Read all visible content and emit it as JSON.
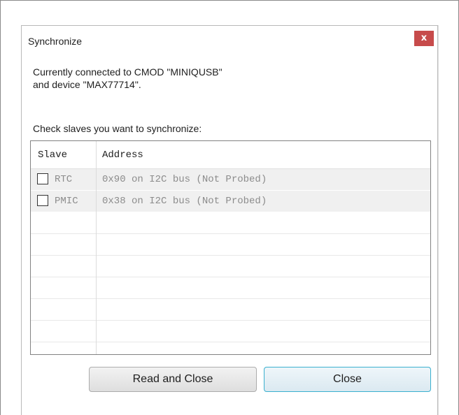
{
  "window": {
    "title": "Synchronize",
    "close_glyph": "x"
  },
  "info": {
    "line1": "Currently connected to CMOD \"MINIQUSB\"",
    "line2": "and device \"MAX77714\"."
  },
  "prompt": "Check slaves you want to synchronize:",
  "table": {
    "headers": {
      "slave": "Slave",
      "address": "Address"
    },
    "rows": [
      {
        "slave": "RTC",
        "address": "0x90 on I2C bus (Not Probed)",
        "checked": false
      },
      {
        "slave": "PMIC",
        "address": "0x38 on I2C bus (Not Probed)",
        "checked": false
      }
    ]
  },
  "buttons": {
    "read_and_close": "Read and Close",
    "close": "Close"
  },
  "colors": {
    "close_button": "#c74b4b",
    "primary_button_border": "#3ab0cf",
    "row_background": "#f0f0f0",
    "disabled_text": "#8c8c8c"
  }
}
